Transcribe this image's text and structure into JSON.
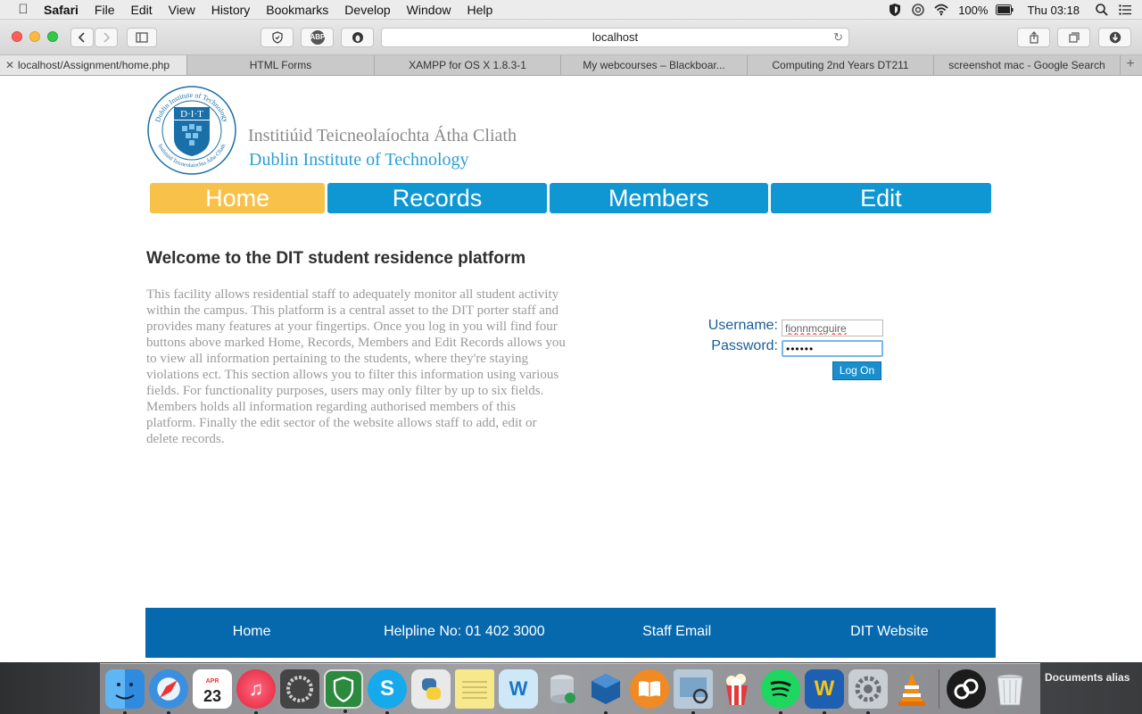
{
  "menubar": {
    "app": "Safari",
    "items": [
      "File",
      "Edit",
      "View",
      "History",
      "Bookmarks",
      "Develop",
      "Window",
      "Help"
    ],
    "battery": "100%",
    "clock": "Thu 03:18"
  },
  "toolbar": {
    "url": "localhost",
    "abp_label": "ABP"
  },
  "tabs": [
    {
      "label": "localhost/Assignment/home.php"
    },
    {
      "label": "HTML Forms"
    },
    {
      "label": "XAMPP for OS X 1.8.3-1"
    },
    {
      "label": "My webcourses – Blackboar..."
    },
    {
      "label": "Computing 2nd Years DT211"
    },
    {
      "label": "screenshot mac - Google Search"
    }
  ],
  "page": {
    "logo": {
      "seal_text": "D·I·T",
      "ring_text_top": "Dublin Institute of Technology",
      "ring_text_bottom": "Institiúid Teicneolaíochta Átha Cliath",
      "line1": "Institiúid Teicneolaíochta Átha Cliath",
      "line2": "Dublin Institute of Technology"
    },
    "nav": [
      {
        "label": "Home",
        "active": true
      },
      {
        "label": "Records",
        "active": false
      },
      {
        "label": "Members",
        "active": false
      },
      {
        "label": "Edit",
        "active": false
      }
    ],
    "welcome_title": "Welcome to the DIT student residence platform",
    "intro": "This facility allows residential staff to adequately monitor all student activity within the campus. This platform is a central asset to the DIT porter staff and provides many features at your fingertips. Once you log in you will find four buttons above marked Home, Records, Members and Edit Records allows you to view all information pertaining to the students, where they're staying violations ect. This section allows you to filter this information using various fields. For functionality purposes, users may only filter by up to six fields. Members holds all information regarding authorised members of this platform. Finally the edit sector of the website allows staff to add, edit or delete records.",
    "login": {
      "username_label": "Username:",
      "username_value": "fionnmcguire",
      "password_label": "Password:",
      "password_value": "••••••",
      "button": "Log On"
    },
    "footer": [
      "Home",
      "Helpline No: 01 402 3000",
      "Staff Email",
      "DIT Website"
    ]
  },
  "dock": {
    "calendar_month": "APR",
    "calendar_day": "23",
    "stack_label": "Documents alias",
    "apps": [
      "Finder",
      "Safari",
      "Calendar",
      "iTunes",
      "System Info",
      "Shield",
      "Skype",
      "Python",
      "Notes",
      "Wunderlist",
      "Database",
      "VirtualBox",
      "iBooks",
      "Preview",
      "Popcorn",
      "Spotify",
      "Word",
      "System Preferences",
      "VLC",
      "Network",
      "Trash"
    ]
  },
  "colors": {
    "nav_blue": "#0e97d3",
    "nav_active": "#f8c14a",
    "footer_blue": "#0769ad",
    "dit_blue": "#2a9fd6"
  }
}
